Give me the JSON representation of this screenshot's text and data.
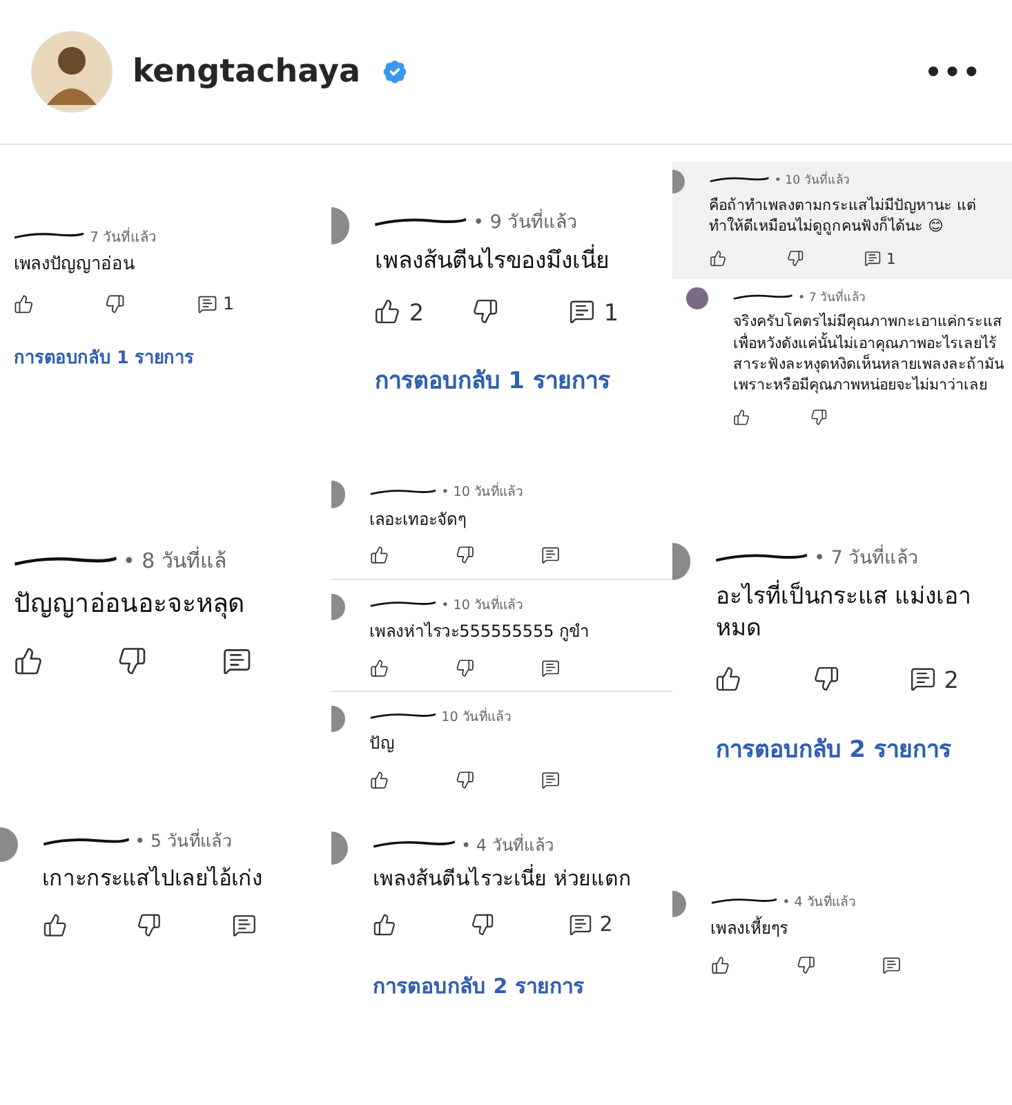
{
  "post": {
    "username": "kengtachaya",
    "verified": true,
    "more": "•••"
  },
  "columns": [
    [
      {
        "kind": "comment",
        "scribbled": true,
        "time": "7 วันที่แล้ว",
        "text": "เพลงปัญญาอ่อน",
        "reply_count": "1",
        "replies_link": "การตอบกลับ 1 รายการ"
      },
      {
        "kind": "comment",
        "scribbled": true,
        "time": "• 8 วันที่แล้",
        "text": "ปัญญาอ่อนอะจะหลุด"
      },
      {
        "kind": "comment",
        "avatar": true,
        "scribbled": true,
        "time": "• 5 วันที่แล้ว",
        "text": "เกาะกระแสไปเลยไอ้เก่ง"
      }
    ],
    [
      {
        "kind": "comment",
        "avatar": true,
        "scribbled": true,
        "time": "• 9 วันที่แล้ว",
        "text": "เพลงส้นตีนไรของมึงเนี่ย",
        "like_count": "2",
        "reply_count": "1",
        "replies_link": "การตอบกลับ 1 รายการ"
      },
      {
        "kind": "comment",
        "avatar": true,
        "scribbled": true,
        "time": "• 10 วันที่แล้ว",
        "text": "เลอะเทอะจัดๆ"
      },
      {
        "kind": "comment",
        "avatar": true,
        "scribbled": true,
        "time": "• 10 วันที่แล้ว",
        "text": "เพลงห่าไรวะ555555555 กูขำ"
      },
      {
        "kind": "comment",
        "avatar": true,
        "scribbled": true,
        "time": "10 วันที่แล้ว",
        "text": "ปัญ"
      },
      {
        "kind": "comment",
        "avatar": true,
        "scribbled": true,
        "time": "• 4 วันที่แล้ว",
        "text": "เพลงส้นตีนไรวะเนี่ย ห่วยแตก",
        "reply_count": "2",
        "replies_link": "การตอบกลับ 2 รายการ"
      }
    ],
    [
      {
        "kind": "comment",
        "avatar": true,
        "scribbled": true,
        "highlighted": true,
        "time": "• 10 วันที่แล้ว",
        "text": "คือถ้าทำเพลงตามกระแสไม่มีปัญหานะ แต่ทำให้ดีเหมือนไม่ดูถูกคนฟังก็ได้นะ 😊",
        "reply_count": "1"
      },
      {
        "kind": "reply",
        "avatar": true,
        "scribbled": true,
        "time": "• 7 วันที่แล้ว",
        "text": "จริงครับโคตรไม่มีคุณภาพกะเอาแค่กระแสเพื่อหวังดังแค่นั้นไม่เอาคุณภาพอะไรเลยไร้สาระฟังละหงุดหงิดเห็นหลายเพลงละถ้ามันเพราะหรือมีคุณภาพหน่อยจะไม่มาว่าเลย"
      },
      {
        "kind": "comment",
        "avatar": true,
        "scribbled": true,
        "time": "• 7 วันที่แล้ว",
        "text": "อะไรที่เป็นกระแส แม่งเอาหมด",
        "reply_count": "2",
        "replies_link": "การตอบกลับ 2 รายการ"
      },
      {
        "kind": "comment",
        "avatar": true,
        "scribbled": true,
        "time": "• 4 วันที่แล้ว",
        "text": "เพลงเหี้ยๆร"
      }
    ]
  ]
}
